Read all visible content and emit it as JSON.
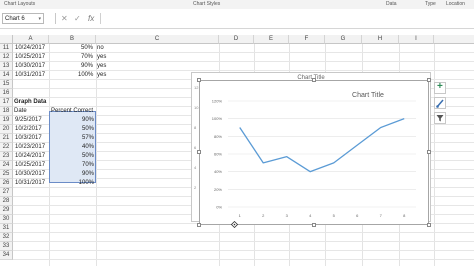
{
  "ribbon": {
    "chart_layouts": "Chart Layouts",
    "chart_styles": "Chart Styles",
    "data": "Data",
    "type": "Type",
    "location": "Location"
  },
  "formula_bar": {
    "name_box": "Chart 6",
    "cancel": "✕",
    "enter": "✓",
    "fx": "fx",
    "value": ""
  },
  "columns": [
    "A",
    "B",
    "C",
    "D",
    "E",
    "F",
    "G",
    "H",
    "I"
  ],
  "rows": [
    "11",
    "12",
    "13",
    "14",
    "15",
    "16",
    "17",
    "18",
    "19",
    "20",
    "21",
    "22",
    "23",
    "24",
    "25",
    "26",
    "27",
    "28",
    "29",
    "30",
    "31",
    "32",
    "33",
    "34"
  ],
  "cells": {
    "r11": {
      "a": "10/24/2017",
      "b": "50%",
      "c": "no"
    },
    "r12": {
      "a": "10/25/2017",
      "b": "70%",
      "c": "yes"
    },
    "r13": {
      "a": "10/30/2017",
      "b": "90%",
      "c": "yes"
    },
    "r14": {
      "a": "10/31/2017",
      "b": "100%",
      "c": "yes"
    },
    "r17": {
      "a": "Graph Data"
    },
    "r18": {
      "a": "Date",
      "b": "Percent Correct"
    },
    "graph_dates": [
      "9/25/2017",
      "10/2/2017",
      "10/3/2017",
      "10/23/2017",
      "10/24/2017",
      "10/25/2017",
      "10/30/2017",
      "10/31/2017"
    ],
    "graph_values": [
      "90%",
      "50%",
      "57%",
      "40%",
      "50%",
      "70%",
      "90%",
      "100%"
    ]
  },
  "back_chart": {
    "title": "Chart Title",
    "ticks": [
      "12",
      "10",
      "8",
      "6",
      "4",
      "2"
    ]
  },
  "chart_data": {
    "type": "line",
    "title": "Chart Title",
    "categories": [
      "1",
      "2",
      "3",
      "4",
      "5",
      "6",
      "7",
      "8"
    ],
    "values": [
      0.9,
      0.5,
      0.57,
      0.4,
      0.5,
      0.7,
      0.9,
      1.0
    ],
    "ylim": [
      0,
      1.2
    ],
    "y_ticks": [
      "0%",
      "20%",
      "40%",
      "60%",
      "80%",
      "100%",
      "120%"
    ],
    "grid": true,
    "line_color": "#5b9bd5"
  },
  "side_buttons": {
    "elements": "+",
    "styles": "brush-icon",
    "filters": "filter-icon"
  }
}
